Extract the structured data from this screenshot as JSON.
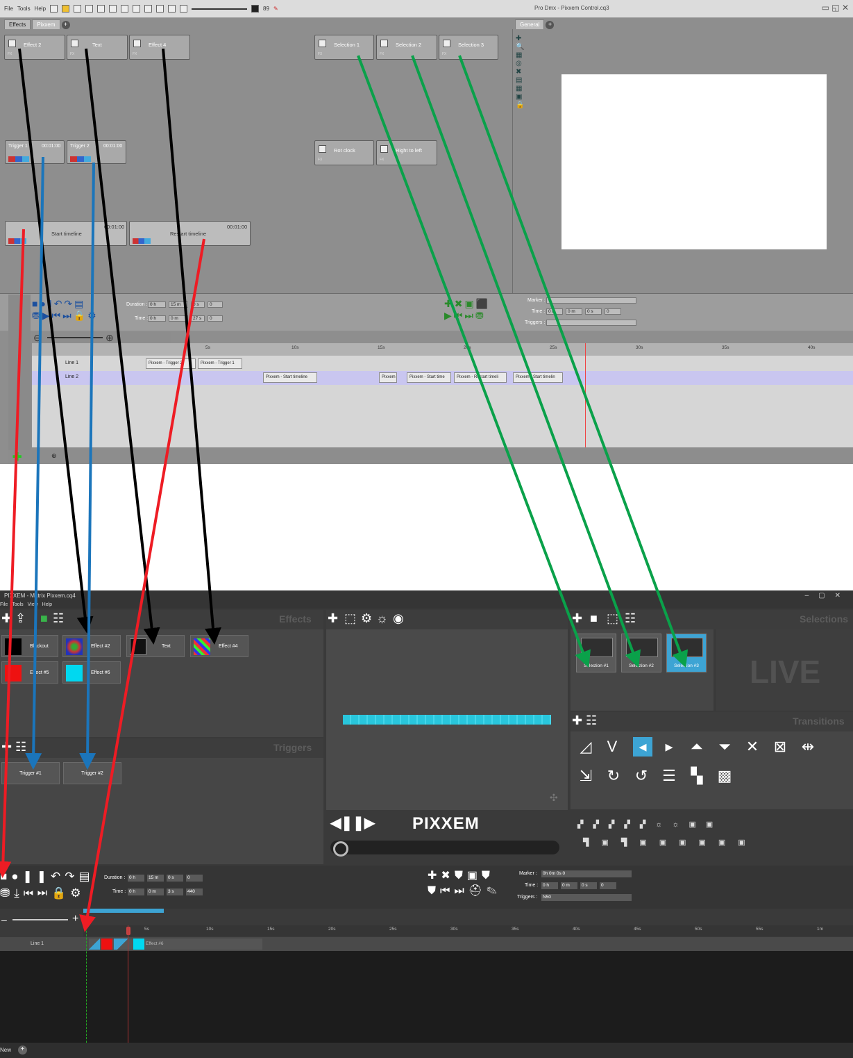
{
  "top": {
    "menu": [
      "File",
      "Tools",
      "Help"
    ],
    "tempo": "89",
    "window_title": "Pro Dmx - Pixxem Control.cq3",
    "tabs": [
      "Effects",
      "Pixxem"
    ],
    "general_tab": "General",
    "effects": [
      "Effect 2",
      "Text",
      "Effect 4"
    ],
    "selections": [
      "Selection 1",
      "Selection 2",
      "Selection 3"
    ],
    "moves": [
      "Rot clock",
      "Right to left"
    ],
    "triggers": [
      {
        "label": "Trigger 1",
        "time": "00:01:00"
      },
      {
        "label": "Trigger 2",
        "time": "00:01:00"
      }
    ],
    "timeline_cmds": [
      {
        "label": "Start timeline",
        "time": "00:01:00"
      },
      {
        "label": "Restart timeline",
        "time": "00:01:00"
      }
    ],
    "fxlabel": "FX",
    "duration": {
      "label": "Duration :",
      "h": "0 h",
      "m": "15 m",
      "s": "0 s",
      "f": "0"
    },
    "time": {
      "label": "Time :",
      "h": "0 h",
      "m": "0 m",
      "s": "27 s",
      "f": "0"
    },
    "marker": {
      "label": "Marker :",
      "time_label": "Time :",
      "h": "0 h",
      "m": "0 m",
      "s": "0 s",
      "f": "0",
      "triggers_label": "Triggers :"
    },
    "ruler": [
      "5s",
      "10s",
      "15s",
      "20s",
      "25s",
      "30s",
      "35s",
      "40s"
    ],
    "lines": [
      {
        "name": "Line 1",
        "clips": [
          "Pixxem - Trigger 2",
          "Pixxem - Trigger 1"
        ]
      },
      {
        "name": "Line 2",
        "clips": [
          "Pixxem - Start timeline",
          "Pixxem",
          "Pixxem - Start time",
          "Pixxem - Restart timeli",
          "Pixxem - Start timelin"
        ]
      }
    ]
  },
  "bottom": {
    "window_title": "PIXXEM - Matrix Pixxem.cq4",
    "menu": [
      "File",
      "Tools",
      "View",
      "Help"
    ],
    "panels": {
      "effects": "Effects",
      "triggers": "Triggers",
      "selections": "Selections",
      "transitions": "Transitions"
    },
    "effects": [
      {
        "label": "Blackout",
        "color": "#000000"
      },
      {
        "label": "Effect #2",
        "color": "#d04060"
      },
      {
        "label": "Text",
        "color": "#101010"
      },
      {
        "label": "Effect #4",
        "color": "#a040a0"
      },
      {
        "label": "Effect #5",
        "color": "#ee1111"
      },
      {
        "label": "Effect #6",
        "color": "#00d8f0"
      }
    ],
    "triggers": [
      "Trigger #1",
      "Trigger #2"
    ],
    "selections": [
      {
        "label": "Selection #1",
        "active": false
      },
      {
        "label": "Selection #2",
        "active": false
      },
      {
        "label": "Selection #3",
        "active": true
      }
    ],
    "live": "LIVE",
    "brand": "PIXXEM",
    "duration": {
      "label": "Duration :",
      "h": "0 h",
      "m": "15 m",
      "s": "0 s",
      "f": "0"
    },
    "time": {
      "label": "Time :",
      "h": "0 h",
      "m": "0 m",
      "s": "3 s",
      "f": "440"
    },
    "marker": {
      "label": "Marker :",
      "value": "0h 0m 0s 0",
      "time_label": "Time :",
      "h": "0 h",
      "m": "0 m",
      "s": "0 s",
      "f": "0",
      "triggers_label": "Triggers :",
      "triggers_value": "N50"
    },
    "ruler": [
      "5s",
      "10s",
      "15s",
      "20s",
      "25s",
      "30s",
      "35s",
      "40s",
      "45s",
      "50s",
      "55s",
      "1m"
    ],
    "line": {
      "name": "Line 1",
      "clip": "Effect #6"
    },
    "footer_tab": "New",
    "accent": "#3da4d4"
  },
  "arrows": {
    "black": "#000000",
    "blue": "#1b75bb",
    "red": "#ee1c24",
    "green": "#0aa14a"
  }
}
